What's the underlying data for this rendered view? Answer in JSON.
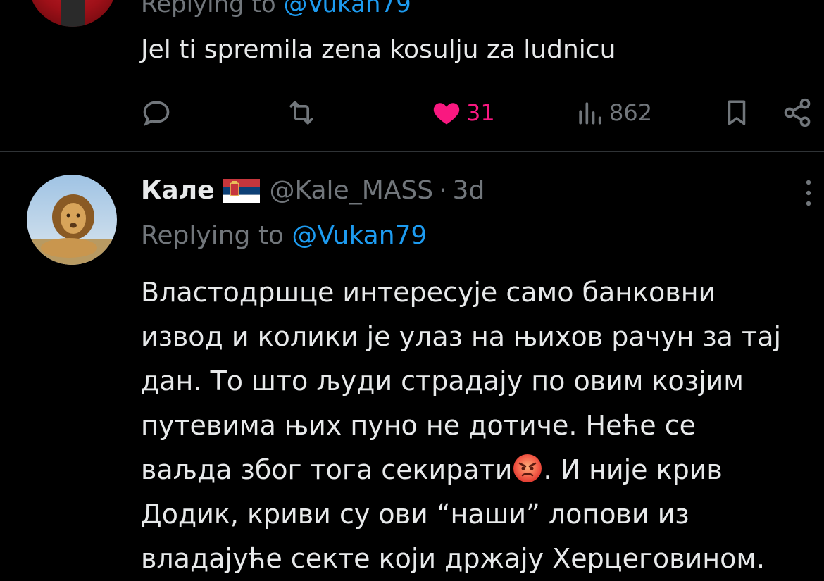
{
  "tweet1": {
    "replying_prefix": "Replying to",
    "replying_handle": "@Vukan79",
    "text": "Jel ti spremila zena kosulju za ludnicu",
    "actions": {
      "replies": "",
      "retweets": "",
      "likes": "31",
      "views": "862"
    }
  },
  "tweet2": {
    "name": "Кале",
    "flag": "serbia-flag",
    "handle": "@Kale_MASS",
    "separator": "·",
    "time": "3d",
    "replying_prefix": "Replying to",
    "replying_handle": "@Vukan79",
    "lines": [
      "Властодршце интересује само банковни",
      "извод и колики је улаз на њихов рачун за тај",
      "дан. То што људи страдају по овим козјим",
      "путевима њих пуно не дотиче. Неће се",
      "ваљда због тога секирати",
      ". И није крив",
      "Додик, криви су ови “наши” лопови из",
      "владајуће секте који држају Херцеговином."
    ]
  },
  "colors": {
    "background": "#000000",
    "text": "#e7e9ea",
    "muted": "#71767b",
    "link": "#1d9bf0",
    "like": "#f91880",
    "divider": "#2f3336"
  }
}
